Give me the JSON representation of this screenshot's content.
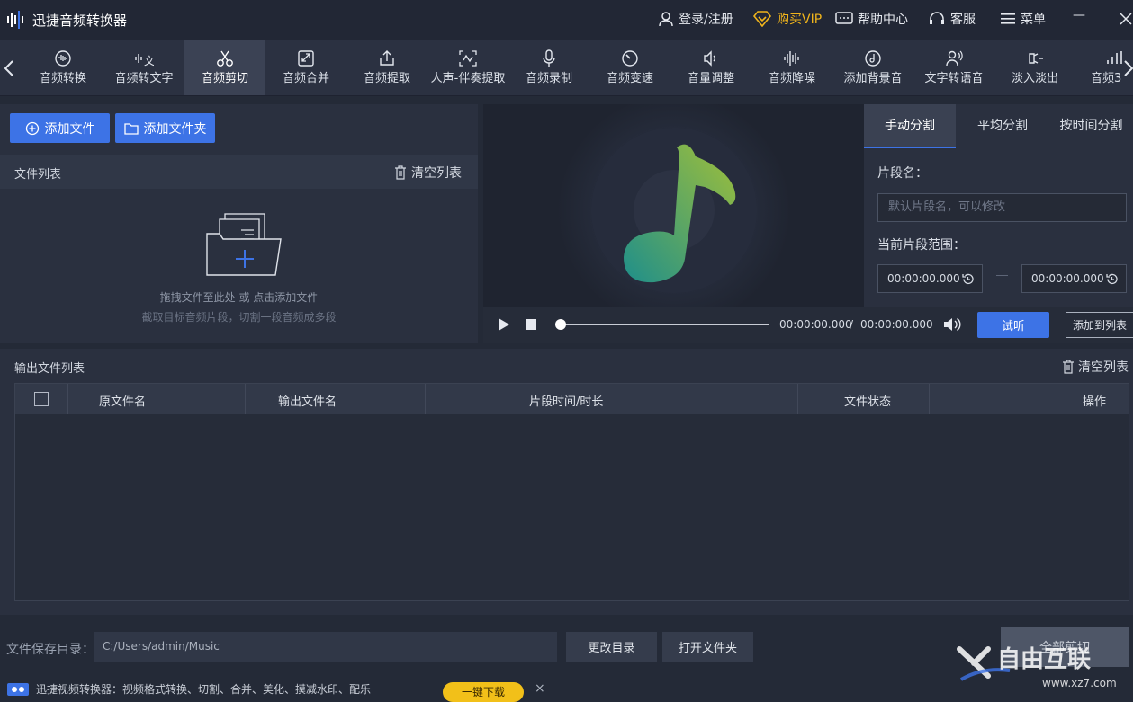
{
  "titlebar": {
    "app_title": "迅捷音频转换器",
    "login": "登录/注册",
    "buy_vip": "购买VIP",
    "help": "帮助中心",
    "service": "客服",
    "menu": "菜单",
    "minimize": "—"
  },
  "toolbar": {
    "tools": [
      {
        "label": "音频转换",
        "icon": "audio-convert-icon"
      },
      {
        "label": "音频转文字",
        "icon": "audio-to-text-icon"
      },
      {
        "label": "音频剪切",
        "icon": "scissors-icon"
      },
      {
        "label": "音频合并",
        "icon": "merge-icon"
      },
      {
        "label": "音频提取",
        "icon": "extract-icon"
      },
      {
        "label": "人声-伴奏提取",
        "icon": "vocal-extract-icon"
      },
      {
        "label": "音频录制",
        "icon": "microphone-icon"
      },
      {
        "label": "音频变速",
        "icon": "speed-icon"
      },
      {
        "label": "音量调整",
        "icon": "volume-icon"
      },
      {
        "label": "音频降噪",
        "icon": "denoise-icon"
      },
      {
        "label": "添加背景音",
        "icon": "background-music-icon"
      },
      {
        "label": "文字转语音",
        "icon": "text-to-speech-icon"
      },
      {
        "label": "淡入淡出",
        "icon": "fade-icon"
      },
      {
        "label": "音频3",
        "icon": "audio-extra-icon"
      }
    ],
    "active_index": 2
  },
  "left": {
    "add_file": "添加文件",
    "add_folder": "添加文件夹",
    "file_list_title": "文件列表",
    "clear_list": "清空列表",
    "drop_hint": "拖拽文件至此处 或 点击添加文件",
    "drop_sub_hint": "截取目标音频片段，切割一段音频成多段"
  },
  "player": {
    "current_time": "00:00:00.000",
    "separator": "/",
    "total_time": "00:00:00.000",
    "progress": 0
  },
  "split": {
    "tabs": [
      "手动分割",
      "平均分割",
      "按时间分割"
    ],
    "active_tab": 0,
    "segment_name_label": "片段名：",
    "segment_name_placeholder": "默认片段名，可以修改",
    "range_label": "当前片段范围：",
    "start_time": "00:00:00.000",
    "end_time": "00:00:00.000",
    "preview": "试听",
    "add_to_list": "添加到列表"
  },
  "output": {
    "title": "输出文件列表",
    "clear_list": "清空列表",
    "columns": [
      "原文件名",
      "输出文件名",
      "片段时间/时长",
      "文件状态",
      "操作"
    ],
    "rows": []
  },
  "footer": {
    "save_dir_label": "文件保存目录：",
    "save_dir_value": "C:/Users/admin/Music",
    "change_dir": "更改目录",
    "open_folder": "打开文件夹",
    "cut_all": "全部剪切",
    "promo_text": "迅捷视频转换器：视频格式转换、切割、合并、美化、摸减水印、配乐",
    "download": "一键下载",
    "close": "×"
  },
  "watermark": {
    "text": "自由互联",
    "url_text": "www.xz7.com"
  },
  "colors": {
    "accent": "#3d73e6",
    "vip": "#f0b41c",
    "background": "#242a37",
    "panel": "#2a303f"
  }
}
